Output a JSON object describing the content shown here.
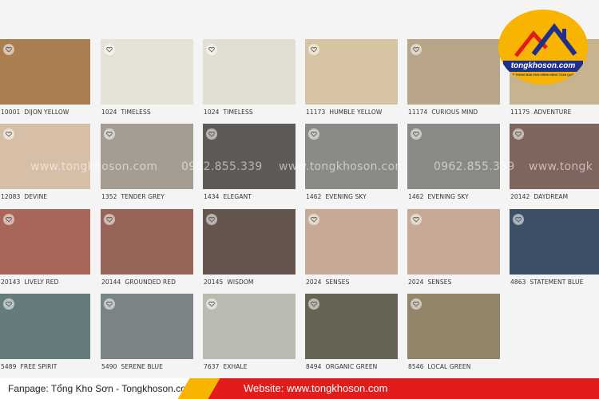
{
  "swatches": [
    {
      "code": "10001",
      "name": "DIJON YELLOW",
      "color": "#a97f52"
    },
    {
      "code": "1024",
      "name": "TIMELESS",
      "color": "#e5e2d8"
    },
    {
      "code": "1024",
      "name": "TIMELESS",
      "color": "#e1ded3"
    },
    {
      "code": "11173",
      "name": "HUMBLE YELLOW",
      "color": "#d6c4a3"
    },
    {
      "code": "11174",
      "name": "CURIOUS MIND",
      "color": "#b8a488"
    },
    {
      "code": "11175",
      "name": "ADVENTURE",
      "color": "#c7b38e"
    },
    {
      "code": "12083",
      "name": "DEVINE",
      "color": "#d7bea7"
    },
    {
      "code": "1352",
      "name": "TENDER GREY",
      "color": "#a59c92"
    },
    {
      "code": "1434",
      "name": "ELEGANT",
      "color": "#5e5a55"
    },
    {
      "code": "1462",
      "name": "EVENING SKY",
      "color": "#8b8a84"
    },
    {
      "code": "1462",
      "name": "EVENING SKY",
      "color": "#8a8983"
    },
    {
      "code": "20142",
      "name": "DAYDREAM",
      "color": "#7e665e"
    },
    {
      "code": "20143",
      "name": "LIVELY RED",
      "color": "#a9675a"
    },
    {
      "code": "20144",
      "name": "GROUNDED RED",
      "color": "#97645a"
    },
    {
      "code": "20145",
      "name": "WISDOM",
      "color": "#65554f"
    },
    {
      "code": "2024",
      "name": "SENSES",
      "color": "#c6a997"
    },
    {
      "code": "2024",
      "name": "SENSES",
      "color": "#c6a997"
    },
    {
      "code": "4863",
      "name": "STATEMENT BLUE",
      "color": "#3d5068"
    },
    {
      "code": "5489",
      "name": "FREE SPIRIT",
      "color": "#667c7c"
    },
    {
      "code": "5490",
      "name": "SERENE BLUE",
      "color": "#7b8484"
    },
    {
      "code": "7637",
      "name": "EXHALE",
      "color": "#b9bbb1"
    },
    {
      "code": "8494",
      "name": "ORGANIC GREEN",
      "color": "#666454"
    },
    {
      "code": "8546",
      "name": "LOCAL GREEN",
      "color": "#928669"
    }
  ],
  "watermark": {
    "site": "www.tongkhoson.com",
    "phone": "0962.855.339",
    "site_cut": "www.tongk"
  },
  "logo": {
    "brand": "tongkhoson.com",
    "tagline": "HỆ THỐNG BÁN SƠN CHÍNH HÃNG TOÀN QUỐC"
  },
  "footer": {
    "fanpage": "Fanpage: Tổng Kho Sơn - Tongkhoson.com",
    "website": "Website: www.tongkhoson.com"
  },
  "colors": {
    "accent_yellow": "#f7b400",
    "accent_red": "#e21b1b",
    "logo_blue": "#1e2f8c"
  }
}
